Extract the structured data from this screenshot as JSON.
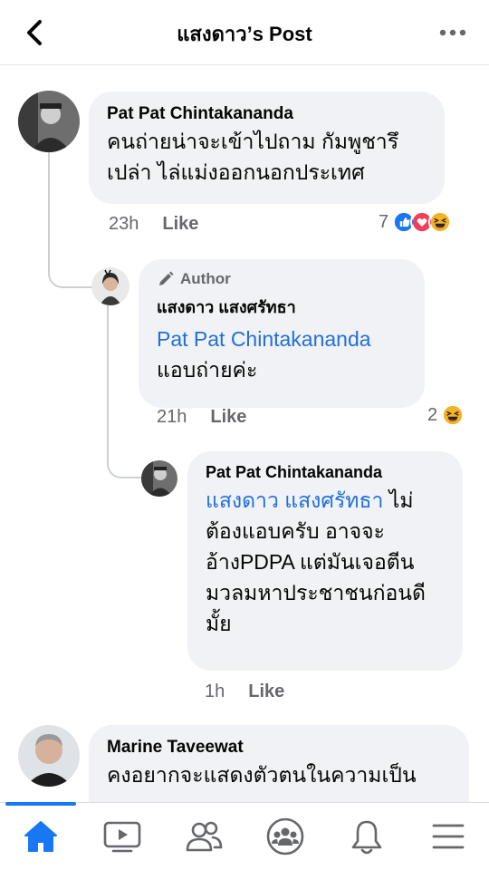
{
  "header": {
    "title": "แสงดาว’s Post",
    "back_icon": "chevron-left-icon",
    "more_icon": "more-horizontal-icon"
  },
  "comments": [
    {
      "name": "Pat Pat Chintakananda",
      "lines": [
        "คนถ่ายน่าจะเข้าไปถาม กัมพูชารึ",
        "เปล่า ไล่แม่งออกนอกประเทศ"
      ],
      "time": "23h",
      "like": "Like",
      "reaction_count": "7",
      "reactions": [
        "like",
        "love",
        "haha"
      ]
    },
    {
      "badge": "Author",
      "name": "แสงดาว แสงศรัทธา",
      "mention": "Pat Pat Chintakananda",
      "lines": [
        "แอบถ่ายค่ะ"
      ],
      "time": "21h",
      "like": "Like",
      "reaction_count": "2",
      "reactions": [
        "haha"
      ]
    },
    {
      "name": "Pat Pat Chintakananda",
      "mention": "แสงดาว แสงศรัทธา",
      "mention_tail": " ไม่",
      "lines": [
        "ต้องแอบครับ อาจจะ",
        "อ้างPDPA แต่มันเจอตีน",
        "มวลมหาประชาชนก่อนดี",
        "มั้ย"
      ],
      "time": "1h",
      "like": "Like"
    },
    {
      "name": "Marine Taveewat",
      "lines": [
        "คงอยากจะแสดงตัวตนในความเป็น"
      ]
    }
  ],
  "tabs": [
    {
      "icon": "home-icon",
      "active": true
    },
    {
      "icon": "video-icon",
      "active": false
    },
    {
      "icon": "friends-icon",
      "active": false
    },
    {
      "icon": "groups-icon",
      "active": false
    },
    {
      "icon": "bell-icon",
      "active": false
    },
    {
      "icon": "menu-icon",
      "active": false
    }
  ],
  "colors": {
    "accent": "#1877f2",
    "mention": "#216fdb",
    "bubble": "#f0f2f5",
    "meta": "#65676b"
  }
}
